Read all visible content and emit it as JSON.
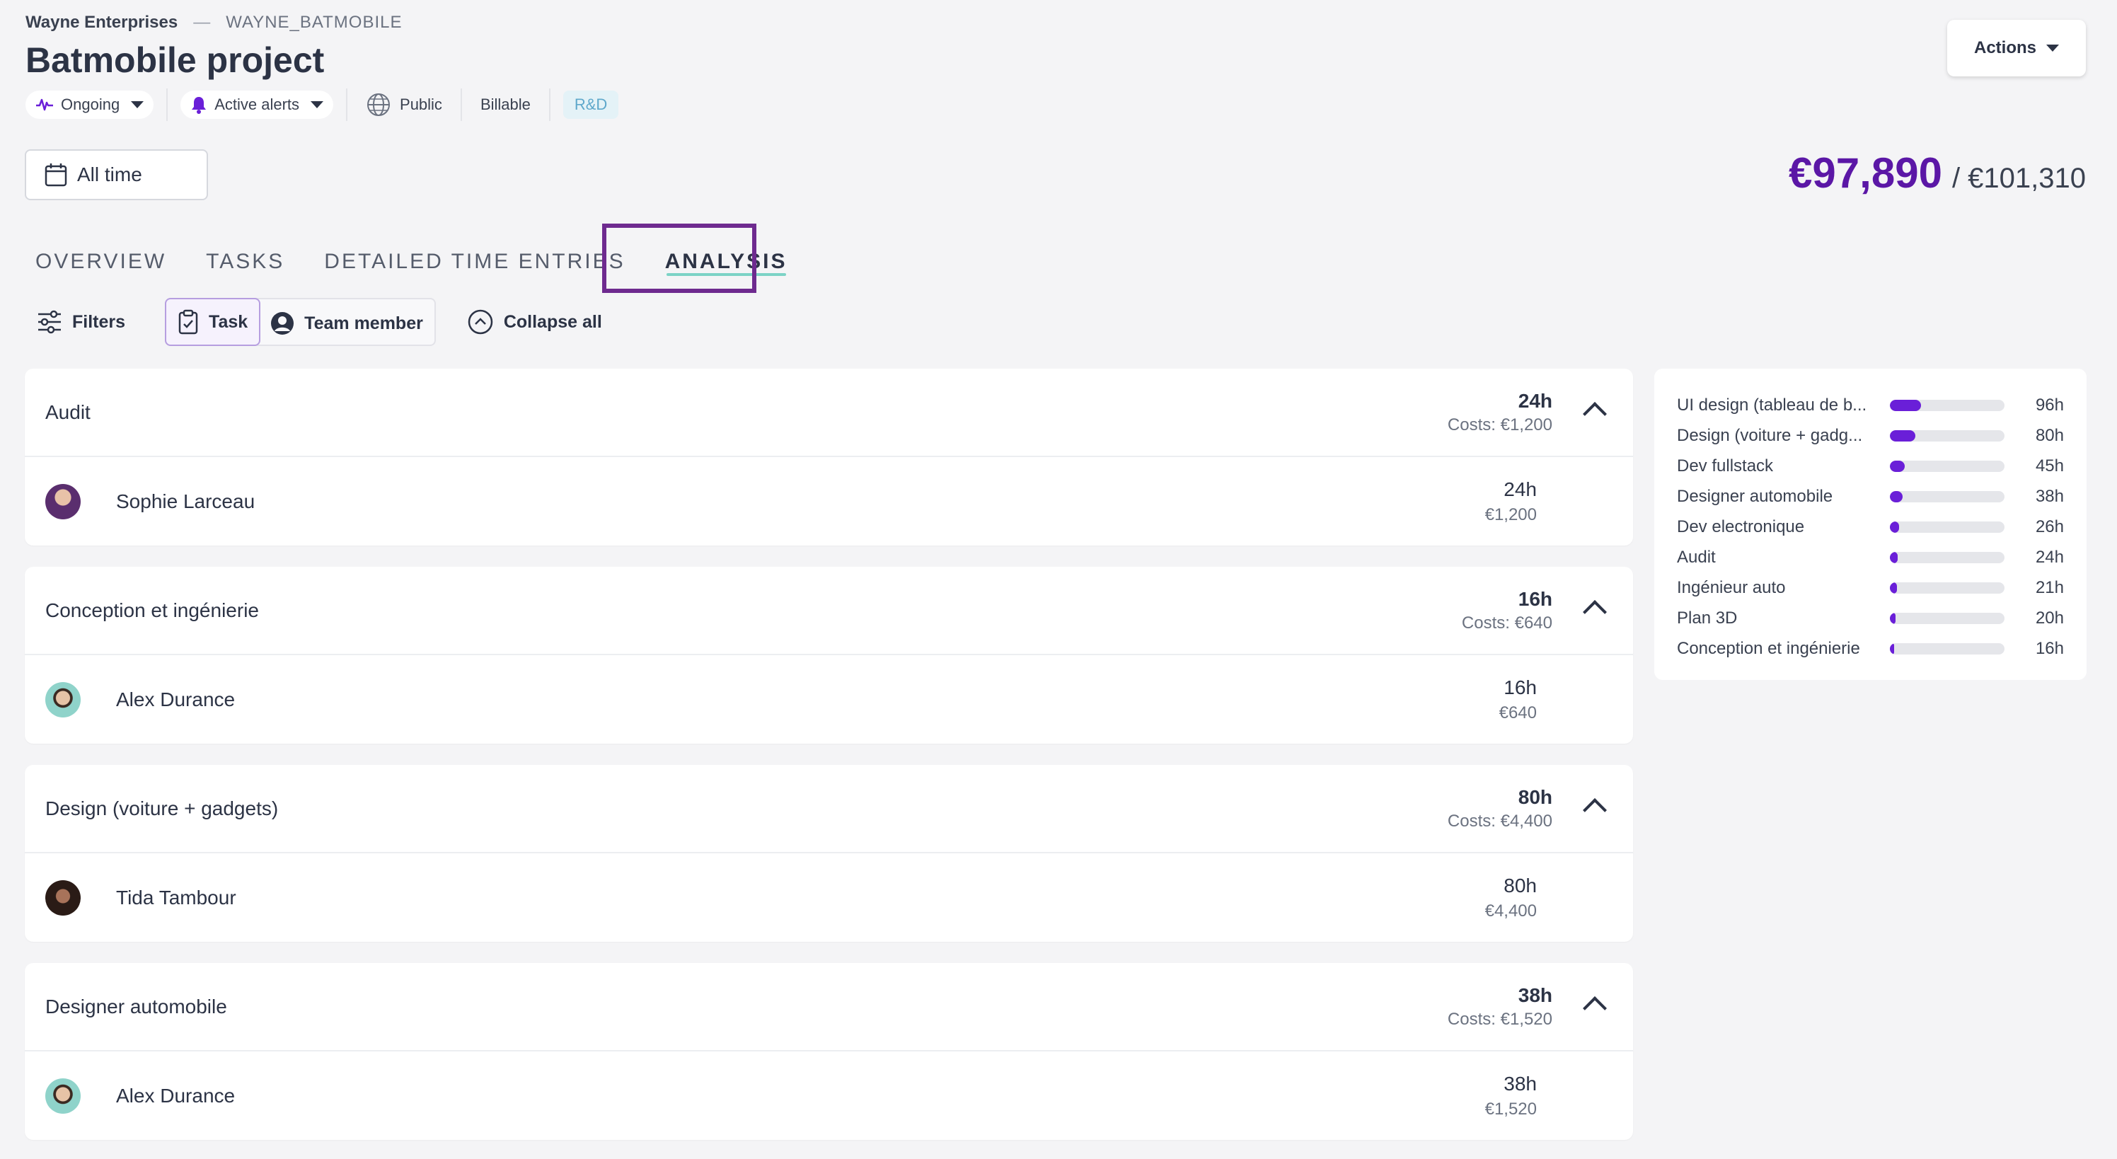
{
  "header": {
    "org": "Wayne Enterprises",
    "separator": "—",
    "project_code": "WAYNE_BATMOBILE",
    "title": "Batmobile project",
    "status": "Ongoing",
    "alerts": "Active alerts",
    "visibility": "Public",
    "billing": "Billable",
    "tag": "R&D",
    "actions_label": "Actions"
  },
  "date_filter": "All time",
  "budget": {
    "spent": "€97,890",
    "total": "/ €101,310"
  },
  "tabs": [
    {
      "label": "OVERVIEW",
      "active": false
    },
    {
      "label": "TASKS",
      "active": false
    },
    {
      "label": "DETAILED TIME ENTRIES",
      "active": false
    },
    {
      "label": "ANALYSIS",
      "active": true
    }
  ],
  "toolbar": {
    "filters": "Filters",
    "group_task": "Task",
    "group_member": "Team member",
    "collapse": "Collapse all"
  },
  "groups": [
    {
      "name": "Audit",
      "hours": "24h",
      "costs": "Costs: €1,200",
      "member": {
        "name": "Sophie Larceau",
        "hours": "24h",
        "cost": "€1,200",
        "avatar_color": "#7b4a8c"
      }
    },
    {
      "name": "Conception et ingénierie",
      "hours": "16h",
      "costs": "Costs: €640",
      "member": {
        "name": "Alex Durance",
        "hours": "16h",
        "cost": "€640",
        "avatar_color": "#7fc9bf"
      }
    },
    {
      "name": "Design (voiture + gadgets)",
      "hours": "80h",
      "costs": "Costs: €4,400",
      "member": {
        "name": "Tida Tambour",
        "hours": "80h",
        "cost": "€4,400",
        "avatar_color": "#3c2a24"
      }
    },
    {
      "name": "Designer automobile",
      "hours": "38h",
      "costs": "Costs: €1,520",
      "member": {
        "name": "Alex Durance",
        "hours": "38h",
        "cost": "€1,520",
        "avatar_color": "#7fc9bf"
      }
    }
  ],
  "summary": [
    {
      "label": "UI design (tableau de b...",
      "value": "96h",
      "fraction": 0.27
    },
    {
      "label": "Design (voiture + gadg...",
      "value": "80h",
      "fraction": 0.22
    },
    {
      "label": "Dev fullstack",
      "value": "45h",
      "fraction": 0.13
    },
    {
      "label": "Designer automobile",
      "value": "38h",
      "fraction": 0.11
    },
    {
      "label": "Dev electronique",
      "value": "26h",
      "fraction": 0.08
    },
    {
      "label": "Audit",
      "value": "24h",
      "fraction": 0.07
    },
    {
      "label": "Ingénieur auto",
      "value": "21h",
      "fraction": 0.06
    },
    {
      "label": "Plan 3D",
      "value": "20h",
      "fraction": 0.05
    },
    {
      "label": "Conception et ingénierie",
      "value": "16h",
      "fraction": 0.04
    }
  ],
  "colors": {
    "accent": "#5b17a6",
    "bar": "#6a1fd8",
    "tab_underline": "#7cd3c6",
    "highlight": "#6e2a8f"
  }
}
